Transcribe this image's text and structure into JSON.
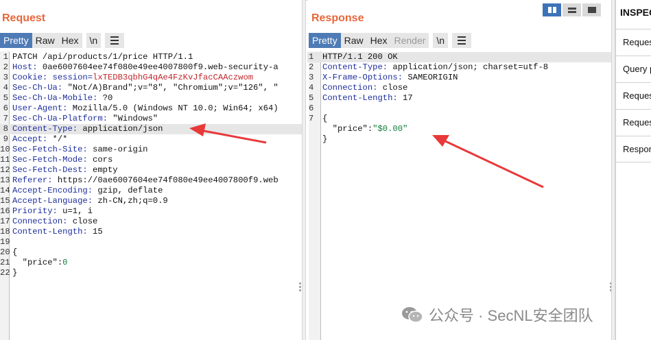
{
  "request": {
    "title": "Request",
    "tabs": [
      "Pretty",
      "Raw",
      "Hex"
    ],
    "newline_btn": "\\n",
    "lines": [
      {
        "n": "1",
        "parts": [
          {
            "t": "PATCH /api/products/1/price HTTP/1.1",
            "c": "hv"
          }
        ]
      },
      {
        "n": "2",
        "parts": [
          {
            "t": "Host:",
            "c": "hk"
          },
          {
            "t": " 0ae6007604ee74f080e49ee4007800f9.web-security-a",
            "c": "hv"
          }
        ]
      },
      {
        "n": "3",
        "parts": [
          {
            "t": "Cookie:",
            "c": "hk"
          },
          {
            "t": " session=",
            "c": "hk"
          },
          {
            "t": "lxTEDB3qbhG4qAe4FzKvJfacCAAczwom",
            "c": "hv red"
          }
        ]
      },
      {
        "n": "4",
        "parts": [
          {
            "t": "Sec-Ch-Ua:",
            "c": "hk"
          },
          {
            "t": " \"Not/A)Brand\";v=\"8\", \"Chromium\";v=\"126\", \"",
            "c": "hv"
          }
        ]
      },
      {
        "n": "5",
        "parts": [
          {
            "t": "Sec-Ch-Ua-Mobile:",
            "c": "hk"
          },
          {
            "t": " ?0",
            "c": "hv"
          }
        ]
      },
      {
        "n": "6",
        "parts": [
          {
            "t": "User-Agent:",
            "c": "hk"
          },
          {
            "t": " Mozilla/5.0 (Windows NT 10.0; Win64; x64)",
            "c": "hv"
          }
        ]
      },
      {
        "n": "7",
        "parts": [
          {
            "t": "Sec-Ch-Ua-Platform:",
            "c": "hk"
          },
          {
            "t": " \"Windows\"",
            "c": "hv"
          }
        ]
      },
      {
        "n": "8",
        "hl": true,
        "parts": [
          {
            "t": "Content-Type:",
            "c": "hk"
          },
          {
            "t": " application/json",
            "c": "hv"
          }
        ]
      },
      {
        "n": "9",
        "parts": [
          {
            "t": "Accept:",
            "c": "hk"
          },
          {
            "t": " */*",
            "c": "hv"
          }
        ]
      },
      {
        "n": "10",
        "parts": [
          {
            "t": "Sec-Fetch-Site:",
            "c": "hk"
          },
          {
            "t": " same-origin",
            "c": "hv"
          }
        ]
      },
      {
        "n": "11",
        "parts": [
          {
            "t": "Sec-Fetch-Mode:",
            "c": "hk"
          },
          {
            "t": " cors",
            "c": "hv"
          }
        ]
      },
      {
        "n": "12",
        "parts": [
          {
            "t": "Sec-Fetch-Dest:",
            "c": "hk"
          },
          {
            "t": " empty",
            "c": "hv"
          }
        ]
      },
      {
        "n": "13",
        "parts": [
          {
            "t": "Referer:",
            "c": "hk"
          },
          {
            "t": " https://0ae6007604ee74f080e49ee4007800f9.web",
            "c": "hv"
          }
        ]
      },
      {
        "n": "14",
        "parts": [
          {
            "t": "Accept-Encoding:",
            "c": "hk"
          },
          {
            "t": " gzip, deflate",
            "c": "hv"
          }
        ]
      },
      {
        "n": "15",
        "parts": [
          {
            "t": "Accept-Language:",
            "c": "hk"
          },
          {
            "t": " zh-CN,zh;q=0.9",
            "c": "hv"
          }
        ]
      },
      {
        "n": "16",
        "parts": [
          {
            "t": "Priority:",
            "c": "hk"
          },
          {
            "t": " u=1, i",
            "c": "hv"
          }
        ]
      },
      {
        "n": "17",
        "parts": [
          {
            "t": "Connection:",
            "c": "hk"
          },
          {
            "t": " close",
            "c": "hv"
          }
        ]
      },
      {
        "n": "18",
        "parts": [
          {
            "t": "Content-Length:",
            "c": "hk"
          },
          {
            "t": " 15",
            "c": "hv"
          }
        ]
      },
      {
        "n": "19",
        "parts": []
      },
      {
        "n": "20",
        "parts": [
          {
            "t": "{",
            "c": "hv"
          }
        ]
      },
      {
        "n": "21",
        "parts": [
          {
            "t": "  \"price\":",
            "c": "jk"
          },
          {
            "t": "0",
            "c": "jv"
          }
        ]
      },
      {
        "n": "22",
        "parts": [
          {
            "t": "}",
            "c": "hv"
          }
        ]
      }
    ]
  },
  "response": {
    "title": "Response",
    "tabs": [
      "Pretty",
      "Raw",
      "Hex",
      "Render"
    ],
    "newline_btn": "\\n",
    "lines": [
      {
        "n": "1",
        "hl": true,
        "parts": [
          {
            "t": "HTTP/1.1 200 OK",
            "c": "hv"
          }
        ]
      },
      {
        "n": "2",
        "parts": [
          {
            "t": "Content-Type:",
            "c": "hk"
          },
          {
            "t": " application/json; charset=utf-8",
            "c": "hv"
          }
        ]
      },
      {
        "n": "3",
        "parts": [
          {
            "t": "X-Frame-Options:",
            "c": "hk"
          },
          {
            "t": " SAMEORIGIN",
            "c": "hv"
          }
        ]
      },
      {
        "n": "4",
        "parts": [
          {
            "t": "Connection:",
            "c": "hk"
          },
          {
            "t": " close",
            "c": "hv"
          }
        ]
      },
      {
        "n": "5",
        "parts": [
          {
            "t": "Content-Length:",
            "c": "hk"
          },
          {
            "t": " 17",
            "c": "hv"
          }
        ]
      },
      {
        "n": "6",
        "parts": []
      },
      {
        "n": "7",
        "parts": [
          {
            "t": "{",
            "c": "hv"
          }
        ]
      },
      {
        "n": "",
        "parts": [
          {
            "t": "  \"price\":",
            "c": "jk"
          },
          {
            "t": "\"$0.00\"",
            "c": "jv"
          }
        ]
      },
      {
        "n": "",
        "parts": [
          {
            "t": "}",
            "c": "hv"
          }
        ]
      }
    ]
  },
  "inspector": {
    "title": "INSPECTOR",
    "items": [
      "Request attributes",
      "Query parameters",
      "Request body parameters",
      "Request cookies",
      "Response headers"
    ]
  },
  "watermark": "公众号 · SecNL安全团队",
  "colors": {
    "accent": "#e8663a",
    "tab_active": "#4e7bb5",
    "arrow": "#e8393a"
  }
}
